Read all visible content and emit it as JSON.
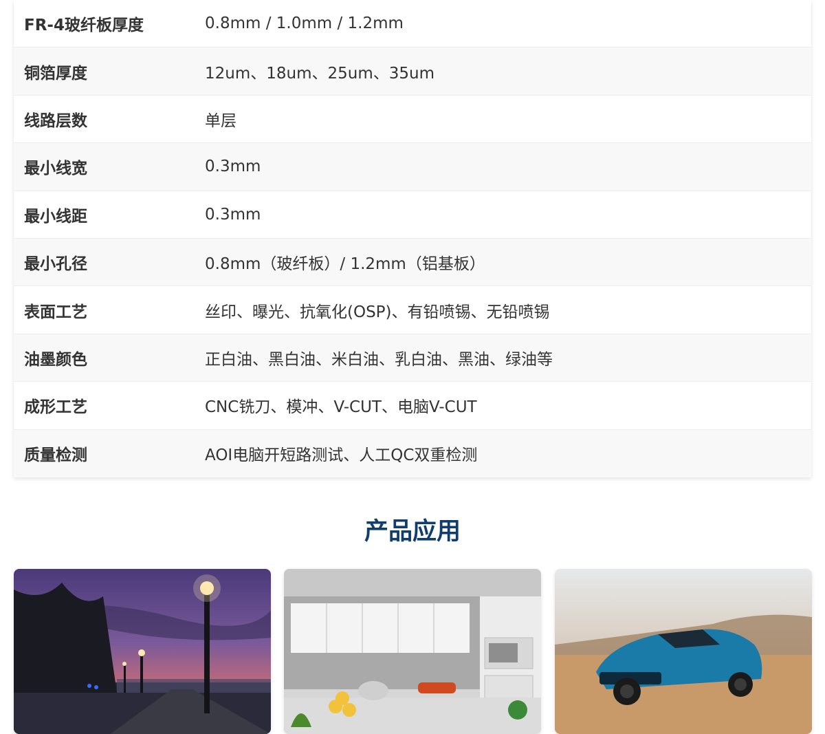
{
  "specs": [
    {
      "label": "FR-4玻纤板厚度",
      "value": "0.8mm / 1.0mm / 1.2mm"
    },
    {
      "label": "铜箔厚度",
      "value": "12um、18um、25um、35um"
    },
    {
      "label": "线路层数",
      "value": "单层"
    },
    {
      "label": "最小线宽",
      "value": "0.3mm"
    },
    {
      "label": "最小线距",
      "value": "0.3mm"
    },
    {
      "label": "最小孔径",
      "value": "0.8mm（玻纤板）/ 1.2mm（铝基板）"
    },
    {
      "label": "表面工艺",
      "value": "丝印、曝光、抗氧化(OSP)、有铅喷锡、无铅喷锡"
    },
    {
      "label": "油墨颜色",
      "value": "正白油、黑白油、米白油、乳白油、黑油、绿油等"
    },
    {
      "label": "成形工艺",
      "value": "CNC铣刀、模冲、V-CUT、电脑V-CUT"
    },
    {
      "label": "质量检测",
      "value": "AOI电脑开短路测试、人工QC双重检测"
    }
  ],
  "applications": {
    "title": "产品应用"
  },
  "colors": {
    "title": "#0f3d6e",
    "text": "#333333",
    "row_alt": "#f8f8f8"
  }
}
